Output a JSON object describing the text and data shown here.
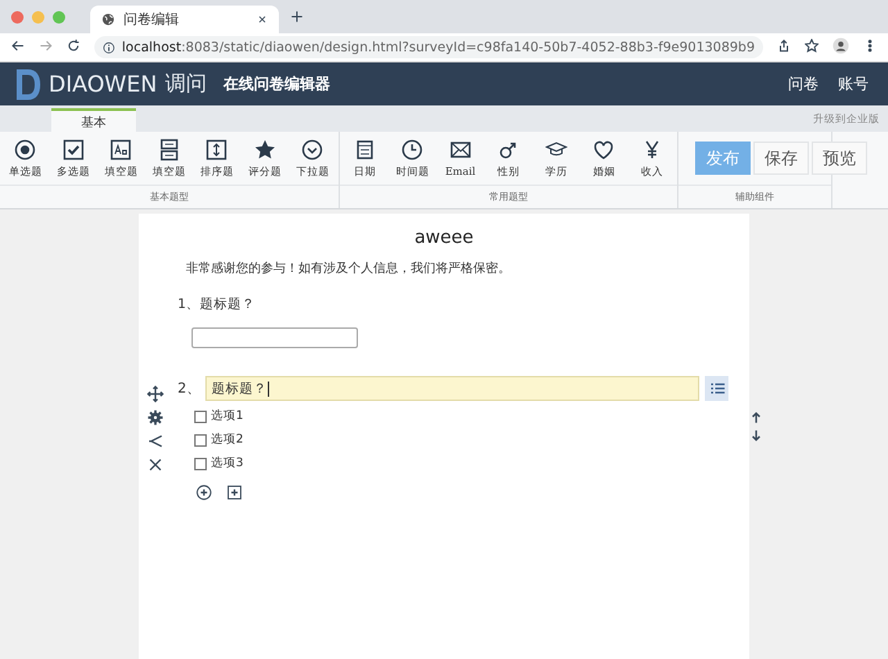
{
  "browser": {
    "tab_title": "问卷编辑",
    "url_host": "localhost",
    "url_rest": ":8083/static/diaowen/design.html?surveyId=c98fa140-50b7-4052-88b3-f9e9013089b9"
  },
  "header": {
    "brand": "DIAOWEN",
    "brand_cn": "调问",
    "subtitle": "在线问卷编辑器",
    "nav": [
      "问卷",
      "账号"
    ]
  },
  "tabs": [
    {
      "label": "基本",
      "selected": true
    }
  ],
  "upgrade_link": "升级到企业版",
  "toolbar": {
    "groups": [
      {
        "label": "基本题型",
        "items": [
          "单选题",
          "多选题",
          "填空题",
          "填空题",
          "排序题",
          "评分题",
          "下拉题"
        ]
      },
      {
        "label": "常用题型",
        "items": [
          "日期",
          "时间题",
          "Email",
          "性别",
          "学历",
          "婚姻",
          "收入"
        ]
      },
      {
        "label": "辅助组件"
      }
    ],
    "buttons": [
      {
        "label": "发布",
        "kind": "primary"
      },
      {
        "label": "保存",
        "kind": "default"
      },
      {
        "label": "预览",
        "kind": "default"
      }
    ]
  },
  "survey": {
    "title": "aweee",
    "intro": "非常感谢您的参与！如有涉及个人信息，我们将严格保密。",
    "questions": [
      {
        "kind": "text",
        "number": "1、",
        "title": "题标题？"
      },
      {
        "kind": "checkbox",
        "number": "2、",
        "title": "题标题？",
        "editing": true,
        "options": [
          {
            "label": "选项1",
            "checked": false
          },
          {
            "label": "选项2",
            "checked": false
          },
          {
            "label": "选项3",
            "checked": false
          }
        ]
      }
    ]
  }
}
